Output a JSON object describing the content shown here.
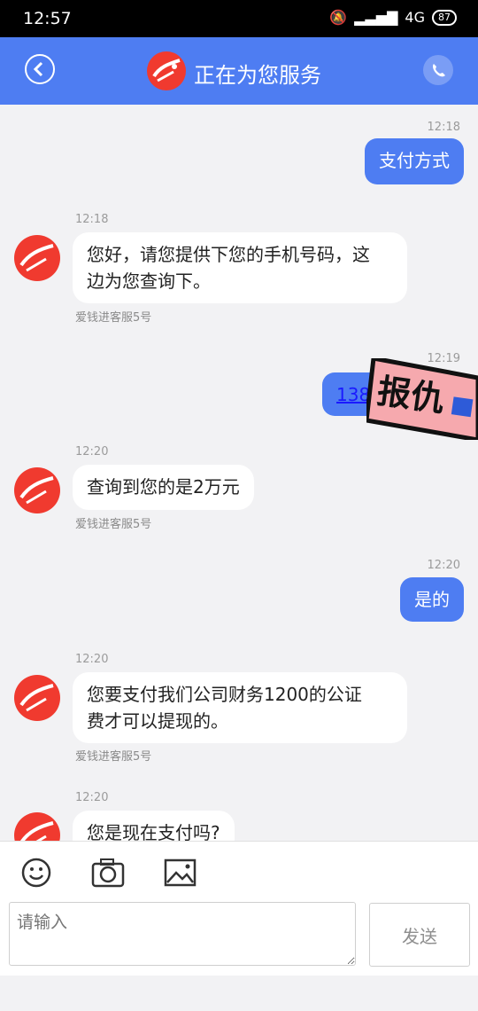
{
  "status_bar": {
    "time": "12:57",
    "network": "4G",
    "battery": "87"
  },
  "header": {
    "title": "正在为您服务"
  },
  "messages": [
    {
      "time": "12:18",
      "text": "支付方式"
    },
    {
      "time": "12:18",
      "text_line1": "您好，请您提供下您的手机号码，这",
      "text_line2": "边为您查询下。",
      "agent": "爱钱进客服5号"
    },
    {
      "time": "12:19",
      "text": "138"
    },
    {
      "time": "12:20",
      "text": "查询到您的是2万元",
      "agent": "爱钱进客服5号"
    },
    {
      "time": "12:20",
      "text": "是的"
    },
    {
      "time": "12:20",
      "text_line1": "您要支付我们公司财务1200的公证",
      "text_line2": "费才可以提现的。",
      "agent": "爱钱进客服5号"
    },
    {
      "time": "12:20",
      "text": "您是现在支付吗?"
    }
  ],
  "sticker": {
    "text": "报仇"
  },
  "input": {
    "placeholder": "请输入",
    "send_label": "发送"
  },
  "colors": {
    "accent": "#4e7df2",
    "logo": "#f03a2f"
  }
}
